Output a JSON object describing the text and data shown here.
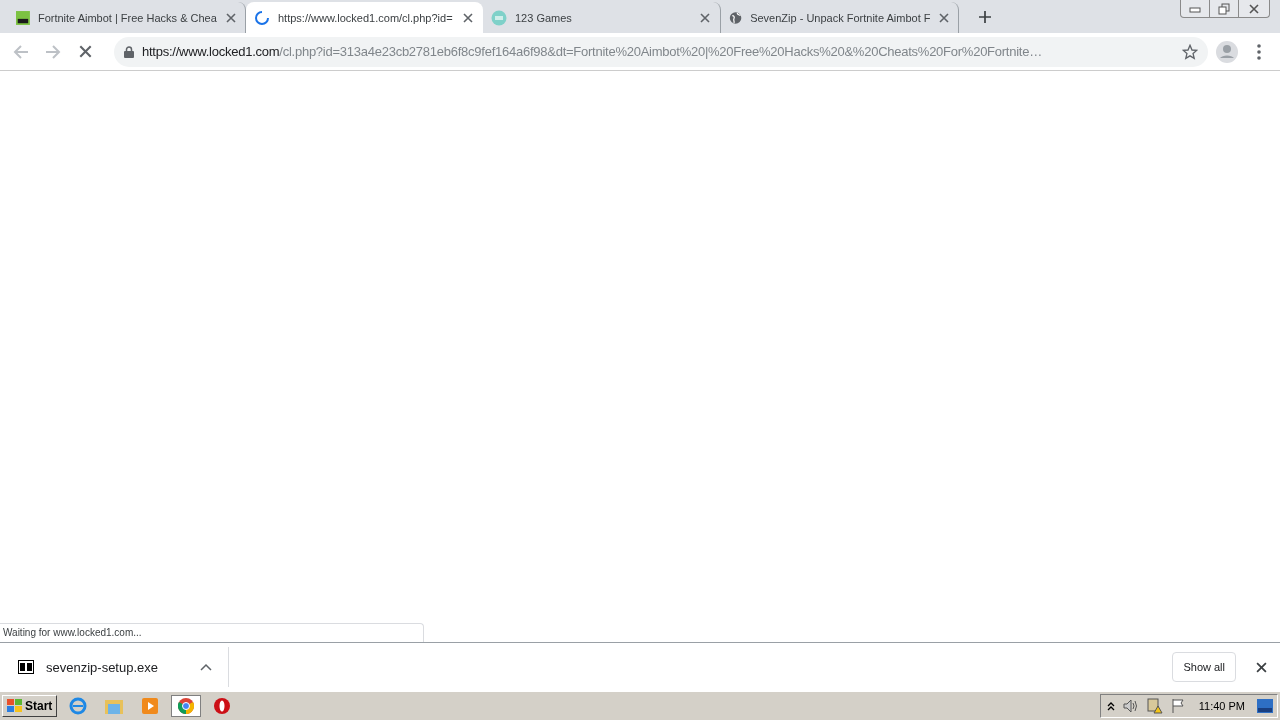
{
  "tabs": [
    {
      "title": "Fortnite Aimbot | Free Hacks & Chea",
      "selected": false,
      "loading": false
    },
    {
      "title": "https://www.locked1.com/cl.php?id=",
      "selected": true,
      "loading": true
    },
    {
      "title": "123 Games",
      "selected": false,
      "loading": false
    },
    {
      "title": "SevenZip - Unpack Fortnite Aimbot F",
      "selected": false,
      "loading": false
    }
  ],
  "address_bar": {
    "host": "https://www.locked1.com",
    "path": "/cl.php?id=313a4e23cb2781eb6f8c9fef164a6f98&dt=Fortnite%20Aimbot%20|%20Free%20Hacks%20&%20Cheats%20For%20Fortnite…",
    "loading": true
  },
  "status": "Waiting for www.locked1.com...",
  "downloads": [
    {
      "filename": "sevenzip-setup.exe"
    }
  ],
  "show_all": "Show all",
  "taskbar": {
    "start": "Start",
    "clock": "11:40 PM"
  }
}
